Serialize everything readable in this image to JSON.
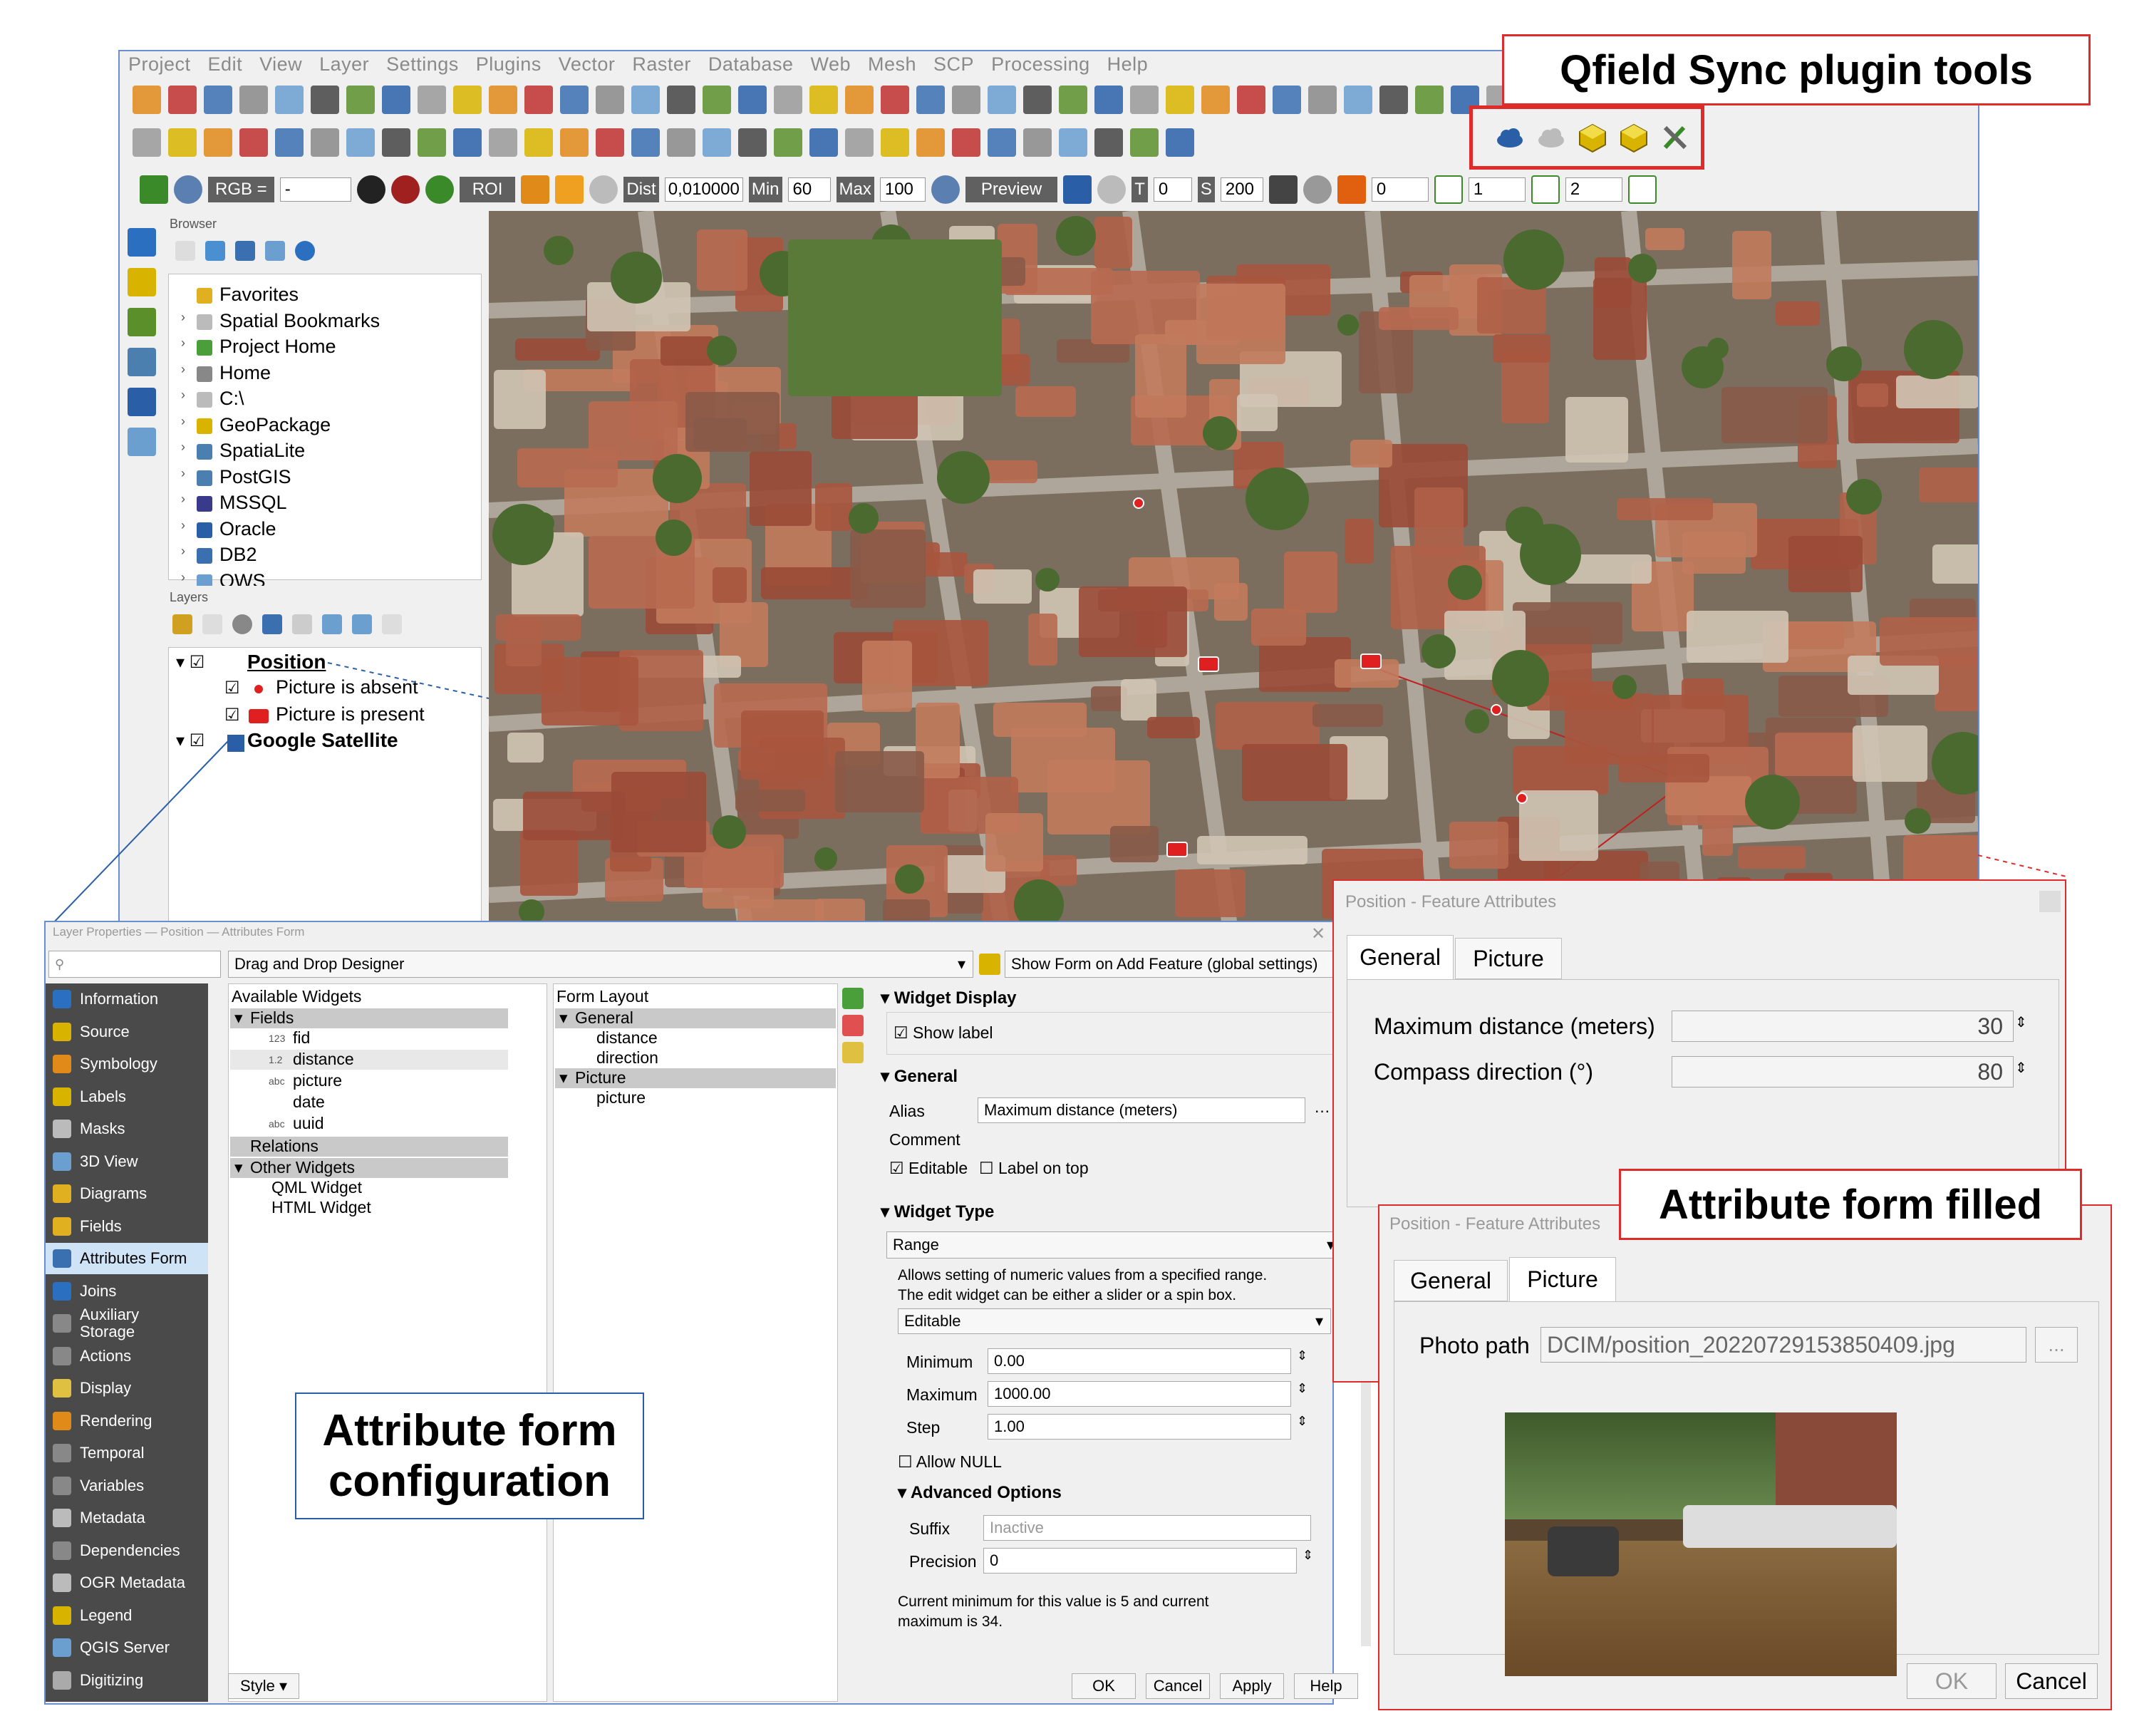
{
  "menu": [
    "Project",
    "Edit",
    "View",
    "Layer",
    "Settings",
    "Plugins",
    "Vector",
    "Raster",
    "Database",
    "Web",
    "Mesh",
    "SCP",
    "Processing",
    "Help"
  ],
  "scp_toolbar": {
    "rgb_label": "RGB =",
    "rgb_value": "-",
    "roi_label": "ROI",
    "dist_label": "Dist",
    "dist_value": "0,010000",
    "min_label": "Min",
    "min_value": "60",
    "max_label": "Max",
    "max_value": "100",
    "preview_label": "Preview",
    "t_label": "T",
    "t_value": "0",
    "s_label": "S",
    "s_value": "200",
    "band1": "0",
    "band2": "1",
    "band3": "2"
  },
  "browser": {
    "title": "Browser",
    "items": [
      "Favorites",
      "Spatial Bookmarks",
      "Project Home",
      "Home",
      "C:\\",
      "GeoPackage",
      "SpatiaLite",
      "PostGIS",
      "MSSQL",
      "Oracle",
      "DB2",
      "OWS"
    ]
  },
  "layers": {
    "title": "Layers",
    "position": "Position",
    "absent": "Picture is absent",
    "present": "Picture is present",
    "google": "Google Satellite"
  },
  "callouts": {
    "qfield": "Qfield Sync plugin tools",
    "filled": "Attribute form filled",
    "config_line1": "Attribute form",
    "config_line2": "configuration"
  },
  "layer_props": {
    "title": "Layer Properties — Position — Attributes Form",
    "designer": "Drag and Drop Designer",
    "show_form": "Show Form on Add Feature (global settings)",
    "sidebar": [
      "Information",
      "Source",
      "Symbology",
      "Labels",
      "Masks",
      "3D View",
      "Diagrams",
      "Fields",
      "Attributes Form",
      "Joins",
      "Auxiliary Storage",
      "Actions",
      "Display",
      "Rendering",
      "Temporal",
      "Variables",
      "Metadata",
      "Dependencies",
      "OGR Metadata",
      "Legend",
      "QGIS Server",
      "Digitizing"
    ],
    "available_widgets": "Available Widgets",
    "fields_group": "Fields",
    "fields": [
      {
        "type": "123",
        "name": "fid"
      },
      {
        "type": "1.2",
        "name": "distance"
      },
      {
        "type": "abc",
        "name": "picture"
      },
      {
        "type": "",
        "name": "date"
      },
      {
        "type": "abc",
        "name": "uuid"
      }
    ],
    "relations": "Relations",
    "other_widgets": "Other Widgets",
    "qml_widget": "QML Widget",
    "html_widget": "HTML Widget",
    "form_layout": "Form Layout",
    "layout": [
      "General",
      "distance",
      "direction",
      "Picture",
      "picture"
    ],
    "widget_display": "Widget Display",
    "show_label": "Show label",
    "general": "General",
    "alias_label": "Alias",
    "alias_value": "Maximum distance (meters)",
    "comment_label": "Comment",
    "editable": "Editable",
    "label_on_top": "Label on top",
    "widget_type": "Widget Type",
    "range": "Range",
    "range_desc1": "Allows setting of numeric values from a specified range.",
    "range_desc2": "The edit widget can be either a slider or a spin box.",
    "editable_select": "Editable",
    "minimum_label": "Minimum",
    "minimum_value": "0.00",
    "maximum_label": "Maximum",
    "maximum_value": "1000.00",
    "step_label": "Step",
    "step_value": "1.00",
    "allow_null": "Allow NULL",
    "advanced": "Advanced Options",
    "suffix_label": "Suffix",
    "suffix_placeholder": "Inactive",
    "precision_label": "Precision",
    "precision_value": "0",
    "current_info1": "Current minimum for this value is 5 and current",
    "current_info2": "maximum is 34.",
    "style": "Style",
    "ok": "OK",
    "cancel": "Cancel",
    "apply": "Apply",
    "help": "Help"
  },
  "feature1": {
    "title": "Position - Feature Attributes",
    "tab_general": "General",
    "tab_picture": "Picture",
    "max_label": "Maximum distance (meters)",
    "max_value": "30",
    "compass_label": "Compass direction (°)",
    "compass_value": "80"
  },
  "feature2": {
    "title": "Position - Feature Attributes",
    "tab_general": "General",
    "tab_picture": "Picture",
    "photo_label": "Photo path",
    "photo_value": "DCIM/position_20220729153850409.jpg",
    "browse": "...",
    "ok": "OK",
    "cancel": "Cancel"
  },
  "colors": {
    "accent_red": "#e02b2b",
    "sidebar_bg": "#4a4a4a",
    "selected_bg": "#cfe3f7",
    "header_bg": "#c9c9c9"
  }
}
